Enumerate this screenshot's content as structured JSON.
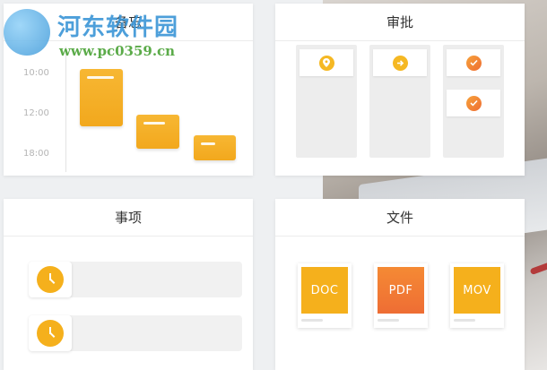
{
  "watermark": {
    "title": "河东软件园",
    "url": "www.pc0359.cn"
  },
  "schedule": {
    "title": "备忘",
    "times": [
      "10:00",
      "12:00",
      "18:00"
    ]
  },
  "approval": {
    "title": "审批",
    "columns": [
      {
        "tiles": [
          "location-icon"
        ]
      },
      {
        "tiles": [
          "arrow-right-icon"
        ]
      },
      {
        "tiles": [
          "check-icon",
          "check-icon"
        ]
      }
    ]
  },
  "items": {
    "title": "事项",
    "rows": [
      "clock-icon",
      "clock-icon"
    ]
  },
  "files": {
    "title": "文件",
    "list": [
      {
        "label": "DOC",
        "color": "#f5b01c"
      },
      {
        "label": "PDF",
        "color": "#ee6d34"
      },
      {
        "label": "MOV",
        "color": "#f5b01c"
      }
    ]
  },
  "colors": {
    "accent": "#f5b01c",
    "accent_orange": "#ee6d34"
  }
}
